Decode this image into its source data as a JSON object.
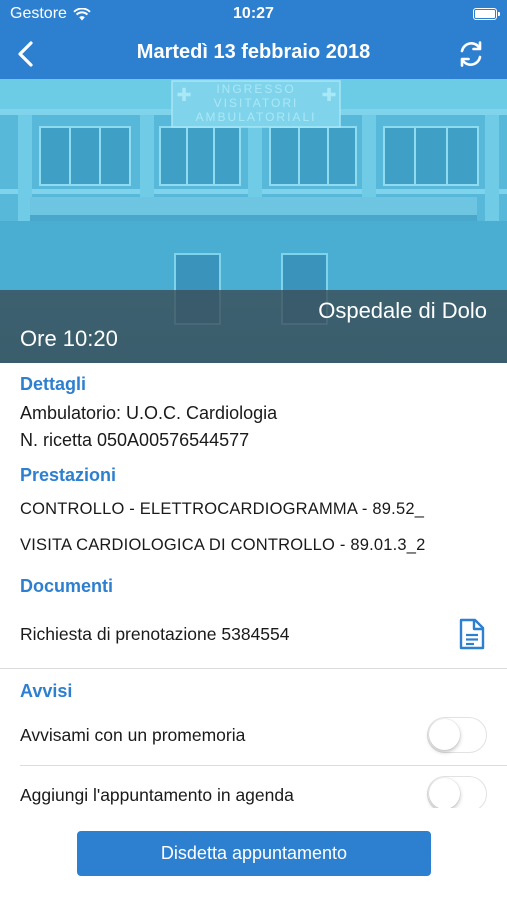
{
  "status": {
    "carrier": "Gestore",
    "time": "10:27"
  },
  "nav": {
    "title": "Martedì 13 febbraio 2018"
  },
  "hero": {
    "sign_text": "INGRESSO VISITATORI AMBULATORIALI",
    "hospital": "Ospedale di Dolo",
    "time_label": "Ore 10:20"
  },
  "details": {
    "title": "Dettagli",
    "ambulatorio": "Ambulatorio: U.O.C. Cardiologia",
    "ricetta": "N. ricetta 050A00576544577"
  },
  "prestazioni": {
    "title": "Prestazioni",
    "items": [
      "CONTROLLO - ELETTROCARDIOGRAMMA - 89.52_",
      "VISITA CARDIOLOGICA DI CONTROLLO - 89.01.3_2"
    ]
  },
  "documenti": {
    "title": "Documenti",
    "items": [
      "Richiesta di prenotazione 5384554"
    ]
  },
  "avvisi": {
    "title": "Avvisi",
    "reminder_label": "Avvisami con un promemoria",
    "reminder_on": false,
    "agenda_label": "Aggiungi l'appuntamento in agenda",
    "agenda_on": false
  },
  "actions": {
    "cancel_label": "Disdetta appuntamento"
  },
  "colors": {
    "primary": "#2d7fd0",
    "overlay": "#3a4b55"
  }
}
